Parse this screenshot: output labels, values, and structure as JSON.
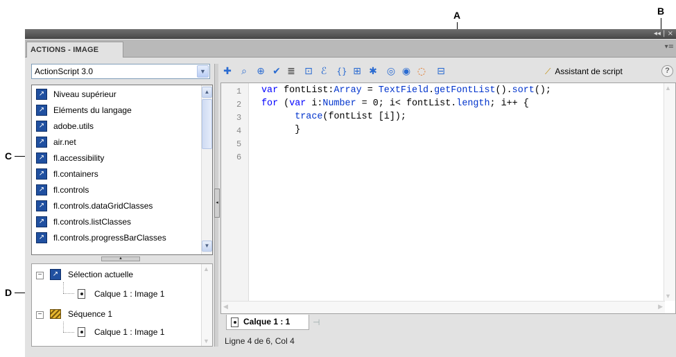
{
  "callouts": {
    "a": "A",
    "b": "B",
    "c": "C",
    "d": "D"
  },
  "window": {
    "panel_tab": "ACTIONS - IMAGE",
    "controls": "◂◂ | ×",
    "panel_menu": "▾≡"
  },
  "language_select": {
    "value": "ActionScript 3.0"
  },
  "toolbox": {
    "items": [
      "Niveau supérieur",
      "Eléments du langage",
      "adobe.utils",
      "air.net",
      "fl.accessibility",
      "fl.containers",
      "fl.controls",
      "fl.controls.dataGridClasses",
      "fl.controls.listClasses",
      "fl.controls.progressBarClasses"
    ]
  },
  "navigator": {
    "current_selection": "Sélection actuelle",
    "current_frame": "Calque 1 : Image 1",
    "scene": "Séquence 1",
    "scene_frame": "Calque 1 : Image 1"
  },
  "toolbar": {
    "tools": [
      "add-statement",
      "find",
      "insert-target-path",
      "check-syntax",
      "auto-format",
      "show-code-hint",
      "debug-options",
      "collapse-between-braces",
      "collapse-selection",
      "expand-all",
      "apply-block-comment",
      "apply-line-comment",
      "remove-comment",
      "show-hide-toolbox"
    ],
    "script_assist_label": "Assistant de script",
    "help": "?"
  },
  "editor": {
    "line_numbers": [
      "1",
      "2",
      "3",
      "4",
      "5",
      "6"
    ],
    "lines": [
      [
        [
          "kw",
          "var"
        ],
        [
          "t",
          " fontList:"
        ],
        [
          "ty",
          "Array"
        ],
        [
          "t",
          " = "
        ],
        [
          "cls",
          "TextField"
        ],
        [
          "t",
          "."
        ],
        [
          "fn",
          "getFontList"
        ],
        [
          "t",
          "()."
        ],
        [
          "fn",
          "sort"
        ],
        [
          "t",
          "();"
        ]
      ],
      [
        [
          "kw",
          "for"
        ],
        [
          "t",
          " ("
        ],
        [
          "kw",
          "var"
        ],
        [
          "t",
          " i:"
        ],
        [
          "ty",
          "Number"
        ],
        [
          "t",
          " = 0; i< fontList."
        ],
        [
          "fn",
          "length"
        ],
        [
          "t",
          "; i++ {"
        ]
      ],
      [
        [
          "t",
          "      "
        ],
        [
          "fn",
          "trace"
        ],
        [
          "t",
          "(fontList [i]);"
        ]
      ],
      [
        [
          "t",
          "      }"
        ]
      ]
    ]
  },
  "script_tab": {
    "label": "Calque 1 : 1"
  },
  "status": {
    "text": "Ligne 4 de 6, Col 4"
  }
}
